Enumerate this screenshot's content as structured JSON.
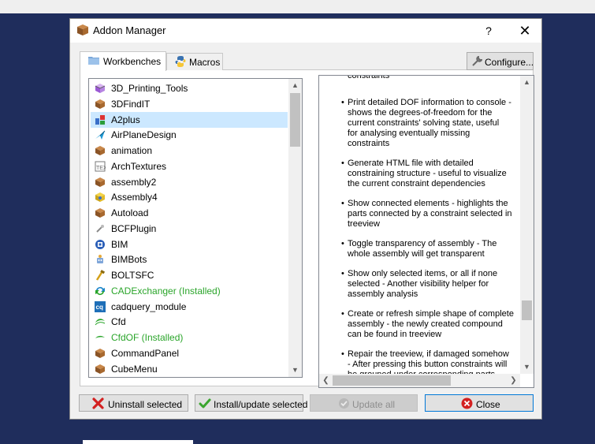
{
  "window": {
    "title": "Addon Manager",
    "help": "?",
    "close_glyph": "✕"
  },
  "tabs": [
    {
      "label": "Workbenches",
      "icon": "folder-icon"
    },
    {
      "label": "Macros",
      "icon": "python-icon"
    }
  ],
  "configure_label": "Configure...",
  "addons": [
    {
      "label": "3D_Printing_Tools",
      "icon": "cube-icon",
      "installed": false,
      "selected": false
    },
    {
      "label": "3DFindIT",
      "icon": "package-icon",
      "installed": false,
      "selected": false
    },
    {
      "label": "A2plus",
      "icon": "a2plus-icon",
      "installed": false,
      "selected": true
    },
    {
      "label": "AirPlaneDesign",
      "icon": "airplane-icon",
      "installed": false,
      "selected": false
    },
    {
      "label": "animation",
      "icon": "package-icon",
      "installed": false,
      "selected": false
    },
    {
      "label": "ArchTextures",
      "icon": "texture-icon",
      "installed": false,
      "selected": false
    },
    {
      "label": "assembly2",
      "icon": "package-icon",
      "installed": false,
      "selected": false
    },
    {
      "label": "Assembly4",
      "icon": "assembly-icon",
      "installed": false,
      "selected": false
    },
    {
      "label": "Autoload",
      "icon": "package-icon",
      "installed": false,
      "selected": false
    },
    {
      "label": "BCFPlugin",
      "icon": "plugin-icon",
      "installed": false,
      "selected": false
    },
    {
      "label": "BIM",
      "icon": "bim-icon",
      "installed": false,
      "selected": false
    },
    {
      "label": "BIMBots",
      "icon": "robot-icon",
      "installed": false,
      "selected": false
    },
    {
      "label": "BOLTSFC",
      "icon": "bolt-icon",
      "installed": false,
      "selected": false
    },
    {
      "label": "CADExchanger (Installed)",
      "icon": "cadexchanger-icon",
      "installed": true,
      "selected": false
    },
    {
      "label": "cadquery_module",
      "icon": "cq-icon",
      "installed": false,
      "selected": false
    },
    {
      "label": "Cfd",
      "icon": "cfd-icon",
      "installed": false,
      "selected": false
    },
    {
      "label": "CfdOF (Installed)",
      "icon": "cfdof-icon",
      "installed": true,
      "selected": false
    },
    {
      "label": "CommandPanel",
      "icon": "package-icon",
      "installed": false,
      "selected": false
    },
    {
      "label": "CubeMenu",
      "icon": "package-icon",
      "installed": false,
      "selected": false
    }
  ],
  "description": [
    {
      "lines": [
        "constraints"
      ],
      "bullet": false
    },
    {
      "lines": [
        "Print detailed DOF information to console -",
        "shows the degrees-of-freedom for the",
        "current constraints' solving state, useful",
        "for analysing eventually missing",
        "constraints"
      ],
      "bullet": true
    },
    {
      "lines": [
        "Generate HTML file with detailed",
        "constraining structure - useful to visualize",
        "the current constraint dependencies"
      ],
      "bullet": true
    },
    {
      "lines": [
        "Show connected elements - highlights the",
        "parts connected by a constraint selected in",
        "treeview"
      ],
      "bullet": true
    },
    {
      "lines": [
        "Toggle transparency of assembly - The",
        "whole assembly will get transparent"
      ],
      "bullet": true
    },
    {
      "lines": [
        "Show only selected items, or all if none",
        "selected - Another visibility helper for",
        "assembly analysis"
      ],
      "bullet": true
    },
    {
      "lines": [
        "Create or refresh simple shape of complete",
        "assembly - the newly created compound",
        "can be found in treeview"
      ],
      "bullet": true
    },
    {
      "lines": [
        "Repair the treeview, if damaged somehow",
        "- After pressing this button constraints will",
        "be grouped under corresponding parts"
      ],
      "bullet": true
    }
  ],
  "buttons": {
    "uninstall": "Uninstall selected",
    "install": "Install/update selected",
    "update_all": "Update all",
    "close": "Close"
  },
  "colors": {
    "installed": "#2aa52a",
    "selected_row": "#cce8ff",
    "accent": "#0078d7"
  }
}
